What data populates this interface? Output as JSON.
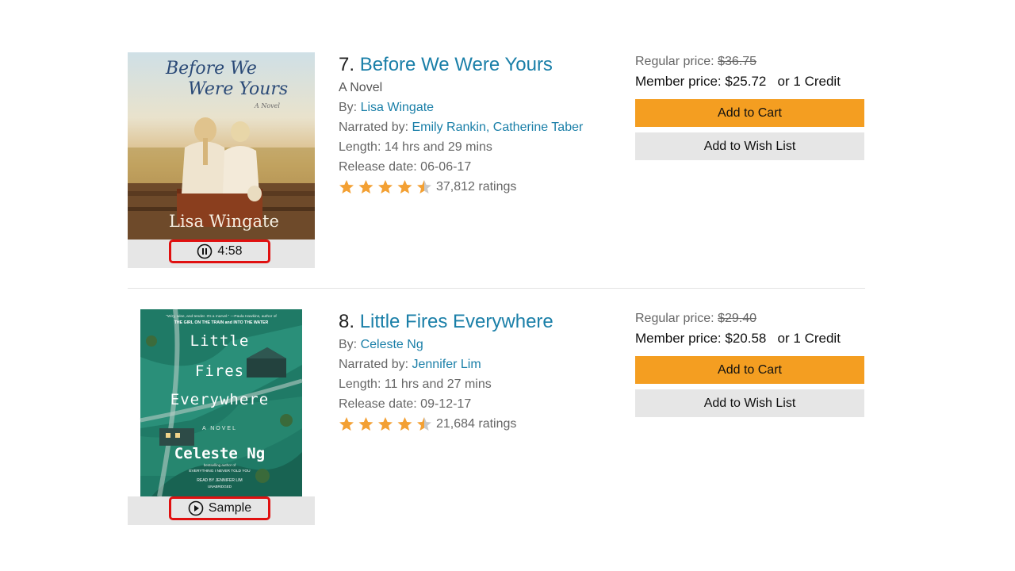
{
  "items": [
    {
      "number": "7.",
      "title": "Before We Were Yours",
      "subtitle": "A Novel",
      "by_label": "By:",
      "author": "Lisa Wingate",
      "narrated_label": "Narrated by:",
      "narrator1": "Emily Rankin",
      "narrator_sep": ",",
      "narrator2": "Catherine Taber",
      "length": "Length: 14 hrs and 29 mins",
      "release": "Release date: 06-06-17",
      "rating_stars": 4.5,
      "ratings": "37,812 ratings",
      "regular_label": "Regular price:",
      "regular_price": "$36.75",
      "member_label": "Member price:",
      "member_price": "$25.72",
      "credit_text": "or 1 Credit",
      "add_to_cart": "Add to Cart",
      "add_to_wishlist": "Add to Wish List",
      "player_icon": "pause-circle-icon",
      "player_label": "4:58",
      "cover": {
        "title_line1": "Before We",
        "title_line2": "Were Yours",
        "tag": "A Novel",
        "author": "Lisa Wingate"
      }
    },
    {
      "number": "8.",
      "title": "Little Fires Everywhere",
      "by_label": "By:",
      "author": "Celeste Ng",
      "narrated_label": "Narrated by:",
      "narrator1": "Jennifer Lim",
      "length": "Length: 11 hrs and 27 mins",
      "release": "Release date: 09-12-17",
      "rating_stars": 4.5,
      "ratings": "21,684 ratings",
      "regular_label": "Regular price:",
      "regular_price": "$29.40",
      "member_label": "Member price:",
      "member_price": "$20.58",
      "credit_text": "or 1 Credit",
      "add_to_cart": "Add to Cart",
      "add_to_wishlist": "Add to Wish List",
      "player_icon": "play-circle-icon",
      "player_label": "Sample",
      "cover": {
        "quote": "\"Wiry, wise, and tender. It's a marvel.\" —Paula Hawkins, author of",
        "quote2": "THE GIRL ON THE TRAIN and INTO THE WATER",
        "title_line1": "Little",
        "title_line2": "Fires",
        "title_line3": "Everywhere",
        "tag": "A NOVEL",
        "author": "Celeste Ng",
        "blurb1": "bestselling author of",
        "blurb2": "EVERYTHING I NEVER TOLD YOU",
        "read_by": "READ BY JENNIFER LIM",
        "unabridged": "UNABRIDGED"
      }
    }
  ],
  "colors": {
    "link": "#1a7fa8",
    "cart": "#f49e21",
    "wish": "#e6e6e6",
    "star": "#f3a033",
    "highlight": "#e01010"
  }
}
